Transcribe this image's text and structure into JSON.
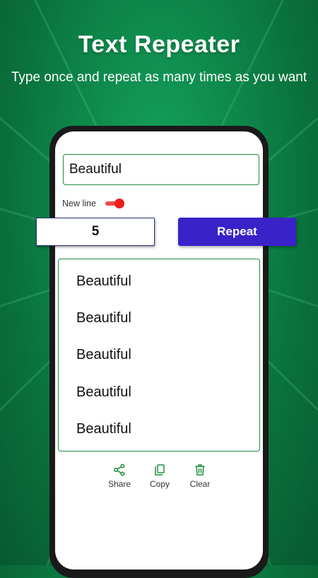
{
  "promo": {
    "title": "Text Repeater",
    "subtitle": "Type once and repeat as many times as you want"
  },
  "app": {
    "input": {
      "value": "Beautiful"
    },
    "new_line": {
      "label": "New line",
      "enabled": true
    },
    "count": {
      "value": "5"
    },
    "repeat_label": "Repeat",
    "output_lines": [
      "Beautiful",
      "Beautiful",
      "Beautiful",
      "Beautiful",
      "Beautiful"
    ],
    "actions": [
      {
        "label": "Share",
        "icon": "share-icon"
      },
      {
        "label": "Copy",
        "icon": "copy-icon"
      },
      {
        "label": "Clear",
        "icon": "trash-icon"
      }
    ]
  },
  "colors": {
    "background": "#0e8a4b",
    "accent_green": "#1e8e3e",
    "repeat_button": "#3a22c9",
    "toggle_red": "#ee1c1c"
  }
}
